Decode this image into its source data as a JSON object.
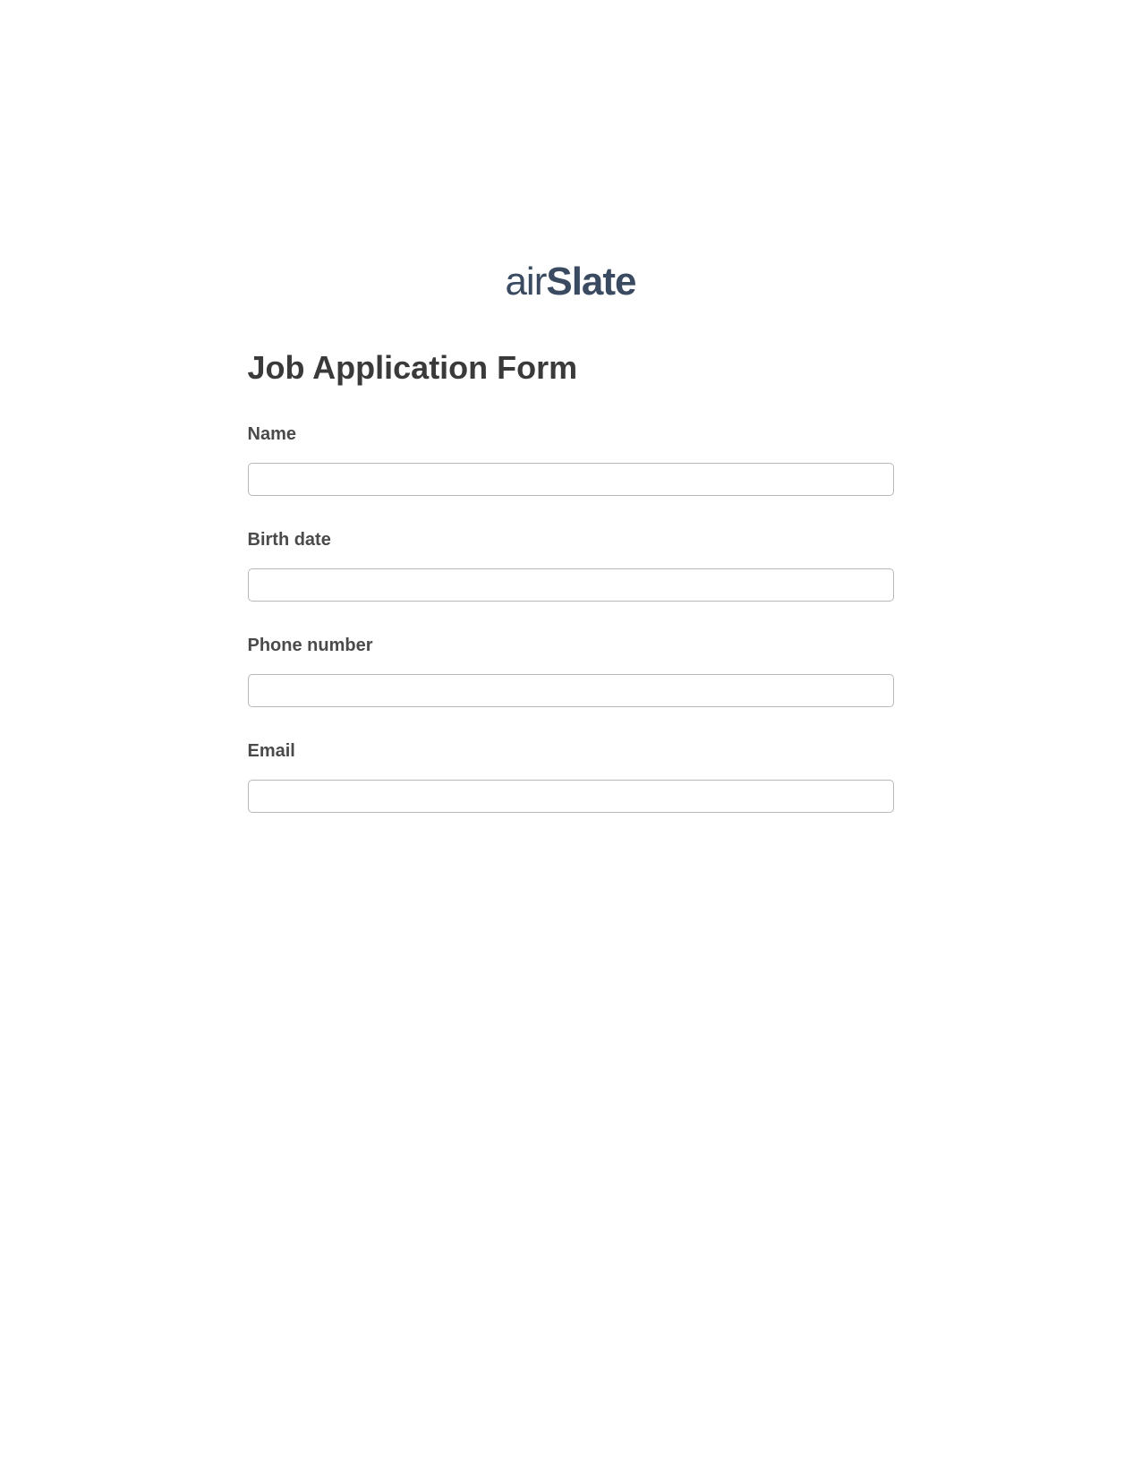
{
  "logo": {
    "prefix": "air",
    "suffix": "Slate"
  },
  "form": {
    "title": "Job Application Form",
    "fields": [
      {
        "label": "Name",
        "value": ""
      },
      {
        "label": "Birth date",
        "value": ""
      },
      {
        "label": "Phone number",
        "value": ""
      },
      {
        "label": "Email",
        "value": ""
      }
    ]
  }
}
